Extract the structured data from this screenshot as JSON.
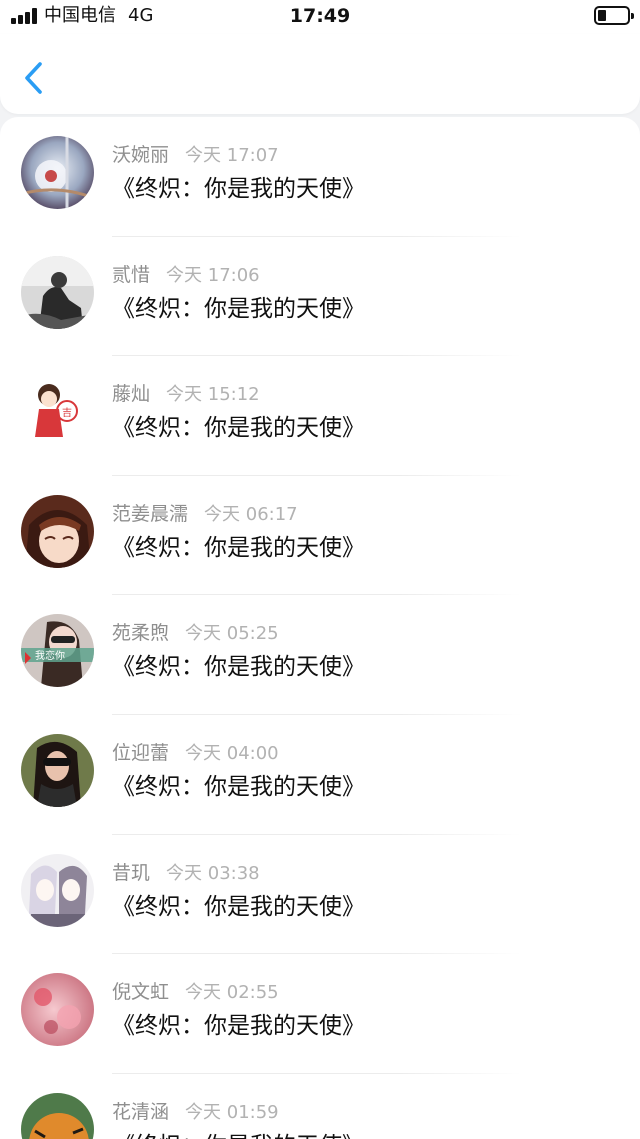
{
  "status_bar": {
    "carrier": "中国电信",
    "network": "4G",
    "time": "17:49"
  },
  "nav": {
    "back_icon": "chevron-left-icon",
    "accent_color": "#2a9df4"
  },
  "comments": [
    {
      "name": "沃婉丽",
      "time": "今天 17:07",
      "message": "《终炽：你是我的天使》",
      "avatar": "glass-ornament-avatar"
    },
    {
      "name": "贰惜",
      "time": "今天 17:06",
      "message": "《终炽：你是我的天使》",
      "avatar": "bw-person-avatar"
    },
    {
      "name": "藤灿",
      "time": "今天 15:12",
      "message": "《终炽：你是我的天使》",
      "avatar": "cartoon-girl-avatar"
    },
    {
      "name": "范姜晨濡",
      "time": "今天 06:17",
      "message": "《终炽：你是我的天使》",
      "avatar": "anime-girl-avatar"
    },
    {
      "name": "苑柔煦",
      "time": "今天 05:25",
      "message": "《终炽：你是我的天使》",
      "avatar": "selfie-sticker-avatar"
    },
    {
      "name": "位迎蕾",
      "time": "今天 04:00",
      "message": "《终炽：你是我的天使》",
      "avatar": "sunglasses-woman-avatar"
    },
    {
      "name": "昔玑",
      "time": "今天 03:38",
      "message": "《终炽：你是我的天使》",
      "avatar": "anime-sketch-avatar"
    },
    {
      "name": "倪文虹",
      "time": "今天 02:55",
      "message": "《终炽：你是我的天使》",
      "avatar": "pink-flower-avatar"
    },
    {
      "name": "花清涵",
      "time": "今天 01:59",
      "message": "《终炽：你是我的天使》",
      "avatar": "tiger-avatar"
    }
  ]
}
